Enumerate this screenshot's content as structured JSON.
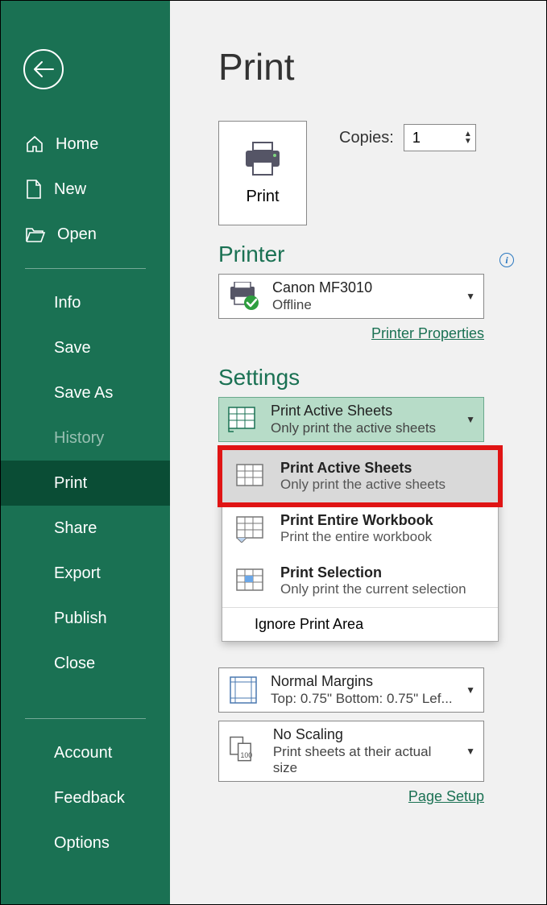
{
  "sidebar": {
    "nav_primary": {
      "home": "Home",
      "new": "New",
      "open": "Open"
    },
    "nav_secondary": {
      "info": "Info",
      "save": "Save",
      "save_as": "Save As",
      "history": "History",
      "print": "Print",
      "share": "Share",
      "export": "Export",
      "publish": "Publish",
      "close": "Close"
    },
    "nav_footer": {
      "account": "Account",
      "feedback": "Feedback",
      "options": "Options"
    }
  },
  "page": {
    "title": "Print",
    "print_button": "Print",
    "copies_label": "Copies:",
    "copies_value": "1"
  },
  "printer": {
    "section_title": "Printer",
    "name": "Canon MF3010",
    "status": "Offline",
    "properties_link": "Printer Properties"
  },
  "settings": {
    "section_title": "Settings",
    "active_sheets": {
      "title": "Print Active Sheets",
      "subtitle": "Only print the active sheets"
    },
    "dropdown_options": {
      "active": {
        "title": "Print Active Sheets",
        "subtitle": "Only print the active sheets"
      },
      "entire": {
        "title": "Print Entire Workbook",
        "subtitle": "Print the entire workbook"
      },
      "selection": {
        "title": "Print Selection",
        "subtitle": "Only print the current selection"
      },
      "ignore": "Ignore Print Area"
    },
    "margins": {
      "title": "Normal Margins",
      "subtitle": "Top: 0.75\" Bottom: 0.75\" Lef..."
    },
    "scaling": {
      "title": "No Scaling",
      "subtitle": "Print sheets at their actual size"
    },
    "page_setup_link": "Page Setup"
  }
}
